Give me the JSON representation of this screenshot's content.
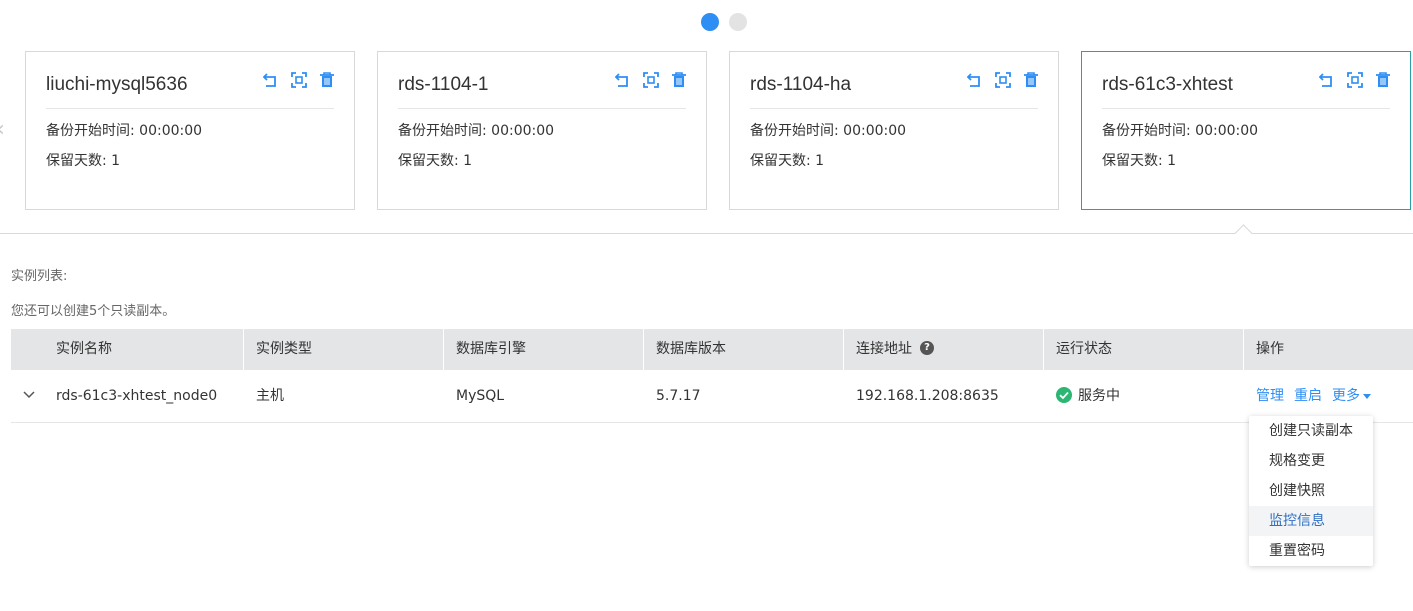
{
  "carousel": {
    "pages": 2,
    "active_page": 1,
    "cards": [
      {
        "name": "liuchi-mysql5636",
        "backup_start": "备份开始时间: 00:00:00",
        "retention": "保留天数: 1"
      },
      {
        "name": "rds-1104-1",
        "backup_start": "备份开始时间: 00:00:00",
        "retention": "保留天数: 1"
      },
      {
        "name": "rds-1104-ha",
        "backup_start": "备份开始时间: 00:00:00",
        "retention": "保留天数: 1"
      },
      {
        "name": "rds-61c3-xhtest",
        "backup_start": "备份开始时间: 00:00:00",
        "retention": "保留天数: 1"
      }
    ],
    "icons": [
      "restore-icon",
      "fullscreen-icon",
      "trash-icon"
    ],
    "selected_card_color": "#2aa1a8"
  },
  "instance_list": {
    "label": "实例列表:",
    "hint": "您还可以创建5个只读副本。",
    "columns": [
      "实例名称",
      "实例类型",
      "数据库引擎",
      "数据库版本",
      "连接地址",
      "运行状态",
      "操作"
    ],
    "rows": [
      {
        "name": "rds-61c3-xhtest_node0",
        "type": "主机",
        "engine": "MySQL",
        "version": "5.7.17",
        "address": "192.168.1.208:8635",
        "status": "服务中",
        "actions": {
          "manage": "管理",
          "restart": "重启",
          "more": "更多"
        }
      }
    ]
  },
  "more_menu": {
    "items": [
      "创建只读副本",
      "规格变更",
      "创建快照",
      "监控信息",
      "重置密码"
    ],
    "hovered": "监控信息"
  },
  "colors": {
    "accent": "#2f8ef4",
    "status_ok": "#2bb673",
    "header_bg": "#e3e5e7"
  }
}
